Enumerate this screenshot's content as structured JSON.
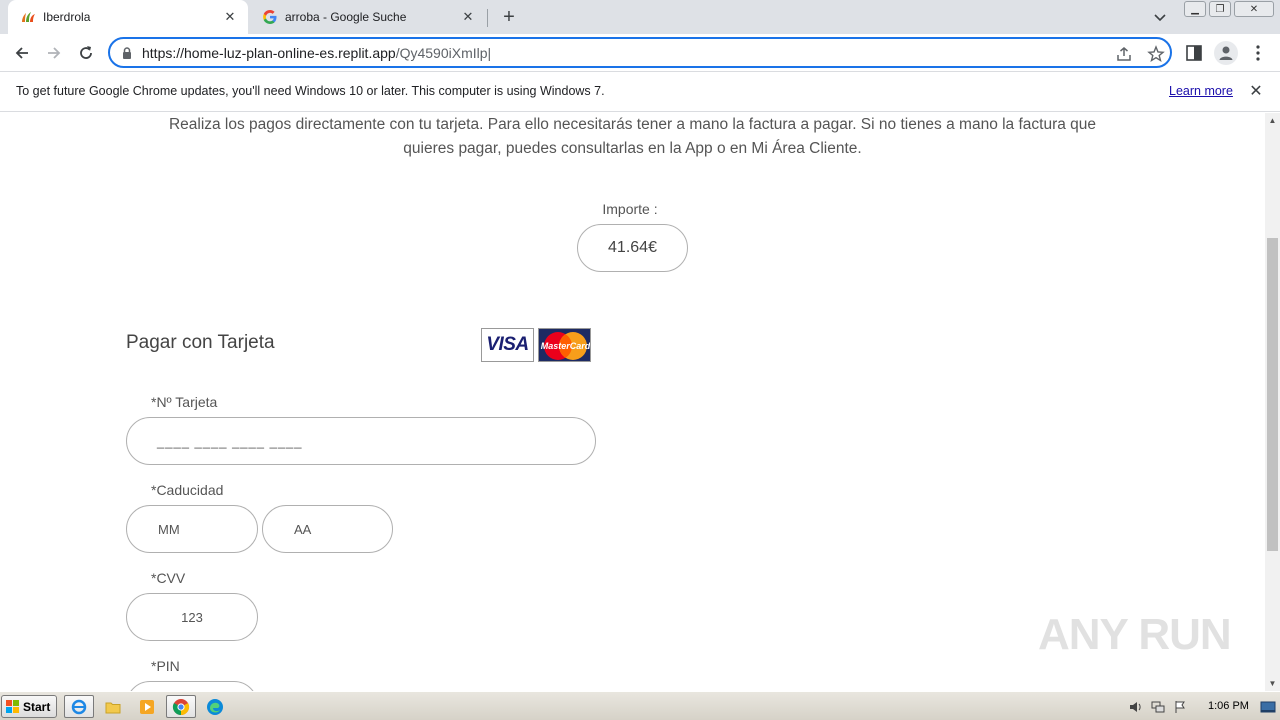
{
  "browser": {
    "tabs": [
      {
        "title": "Iberdrola",
        "active": true,
        "icon": "iberdrola-logo-icon"
      },
      {
        "title": "arroba - Google Suche",
        "active": false,
        "icon": "google-g-icon"
      }
    ],
    "url_host": "https://home-luz-plan-online-es.replit.app",
    "url_path": "/Qy4590iXmIlp",
    "infobar_message": "To get future Google Chrome updates, you'll need Windows 10 or later. This computer is using Windows 7.",
    "infobar_link": "Learn more"
  },
  "page": {
    "intro_text": "Realiza los pagos directamente con tu tarjeta. Para ello necesitarás tener a mano la factura a pagar. Si no tienes a mano la factura que quieres pagar, puedes consultarlas en la App o en Mi Área Cliente.",
    "importe_label": "Importe :",
    "importe_value": "41.64€",
    "pay_title": "Pagar con Tarjeta",
    "card_logos": {
      "visa": "VISA",
      "mastercard": "MasterCard"
    },
    "card_number_label": "*Nº Tarjeta",
    "card_number_placeholder": "____ ____ ____ ____",
    "expiry_label": "*Caducidad",
    "month_placeholder": "MM",
    "year_placeholder": "AA",
    "cvv_label": "*CVV",
    "cvv_placeholder": "123",
    "pin_label": "*PIN"
  },
  "watermark": "ANY RUN",
  "taskbar": {
    "start_label": "Start",
    "clock": "1:06 PM"
  }
}
